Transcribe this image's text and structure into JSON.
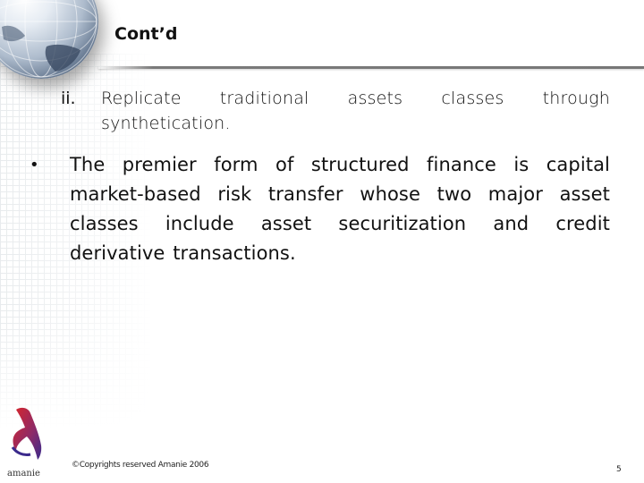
{
  "slide": {
    "title": "Cont’d",
    "sub_item": {
      "marker": "ii.",
      "text": "Replicate traditional assets classes through synthetication."
    },
    "bullet_item": {
      "marker": "•",
      "text": "The premier form of structured finance is capital market-based risk transfer whose two major asset classes include asset securitization and credit derivative transactions."
    },
    "footer": {
      "copyright": "©Copyrights reserved Amanie 2006",
      "page_number": "5",
      "logo_text": "amanie"
    }
  },
  "colors": {
    "text": "#111111",
    "rule": "#777777",
    "logo_red": "#d9262b",
    "logo_purple": "#3b2a8c"
  }
}
